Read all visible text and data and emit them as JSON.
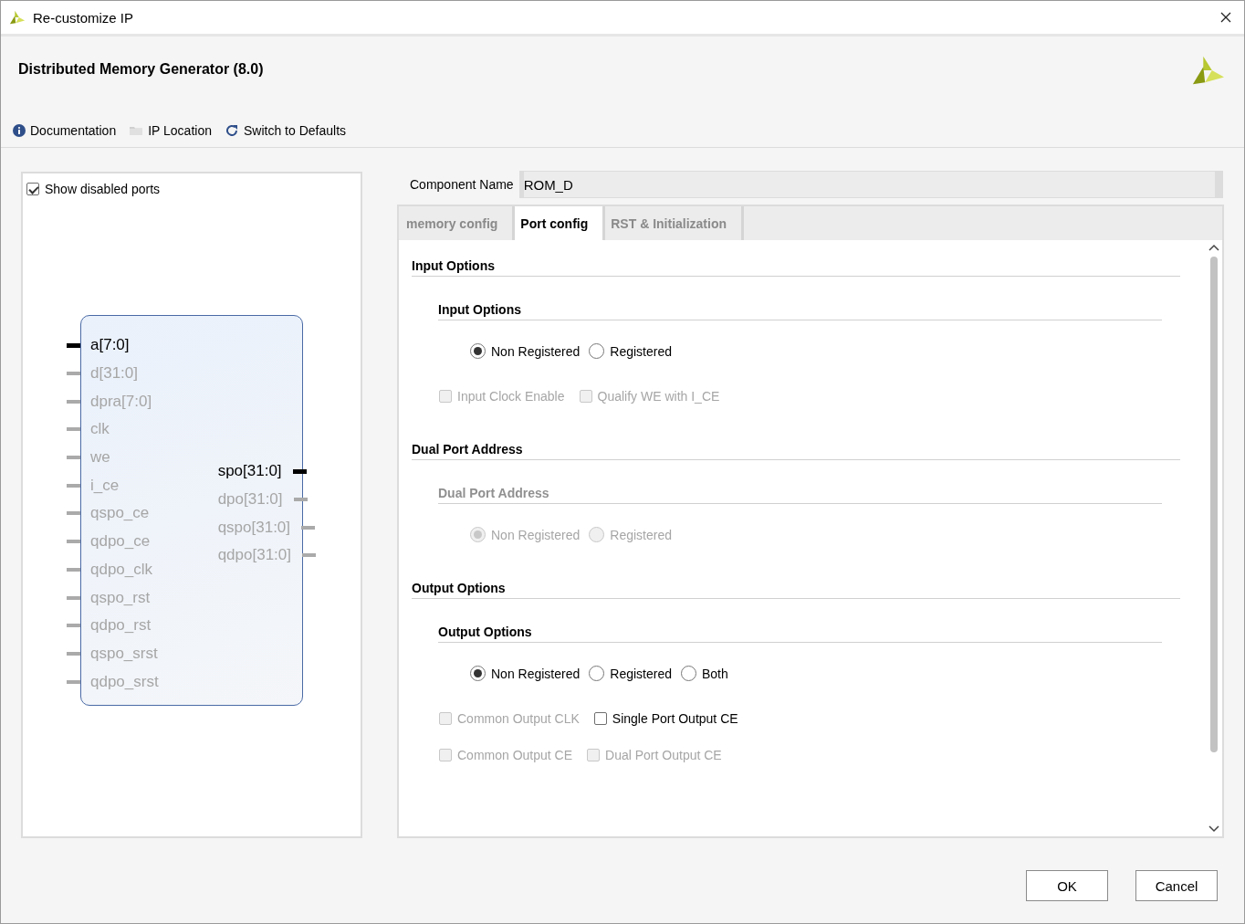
{
  "window": {
    "title": "Re-customize IP"
  },
  "header": {
    "title": "Distributed Memory Generator (8.0)"
  },
  "toolbar": [
    {
      "label": "Documentation",
      "kind": "info"
    },
    {
      "label": "IP Location",
      "kind": "folder"
    },
    {
      "label": "Switch to Defaults",
      "kind": "refresh"
    }
  ],
  "show_disabled_ports": {
    "label": "Show disabled ports",
    "checked": true
  },
  "symbol": {
    "inputs": [
      {
        "name": "a[7:0]",
        "enabled": true
      },
      {
        "name": "d[31:0]",
        "enabled": false
      },
      {
        "name": "dpra[7:0]",
        "enabled": false
      },
      {
        "name": "clk",
        "enabled": false
      },
      {
        "name": "we",
        "enabled": false
      },
      {
        "name": "i_ce",
        "enabled": false
      },
      {
        "name": "qspo_ce",
        "enabled": false
      },
      {
        "name": "qdpo_ce",
        "enabled": false
      },
      {
        "name": "qdpo_clk",
        "enabled": false
      },
      {
        "name": "qspo_rst",
        "enabled": false
      },
      {
        "name": "qdpo_rst",
        "enabled": false
      },
      {
        "name": "qspo_srst",
        "enabled": false
      },
      {
        "name": "qdpo_srst",
        "enabled": false
      }
    ],
    "outputs": [
      {
        "name": "spo[31:0]",
        "enabled": true
      },
      {
        "name": "dpo[31:0]",
        "enabled": false
      },
      {
        "name": "qspo[31:0]",
        "enabled": false
      },
      {
        "name": "qdpo[31:0]",
        "enabled": false
      }
    ]
  },
  "component_name": {
    "label": "Component Name",
    "value": "ROM_D"
  },
  "tabs": [
    {
      "label": "memory config",
      "selected": false
    },
    {
      "label": "Port config",
      "selected": true
    },
    {
      "label": "RST & Initialization",
      "selected": false
    }
  ],
  "sections": [
    {
      "title": "Input Options",
      "subsections": [
        {
          "title": "Input Options",
          "disabled": false,
          "rows": [
            {
              "kind": "radio",
              "items": [
                {
                  "label": "Non Registered",
                  "selected": true,
                  "disabled": false
                },
                {
                  "label": "Registered",
                  "selected": false,
                  "disabled": false
                }
              ]
            },
            {
              "kind": "checkbox",
              "items": [
                {
                  "label": "Input Clock Enable",
                  "checked": false,
                  "disabled": true
                },
                {
                  "label": "Qualify WE with I_CE",
                  "checked": false,
                  "disabled": true
                }
              ]
            }
          ]
        }
      ]
    },
    {
      "title": "Dual Port Address",
      "subsections": [
        {
          "title": "Dual Port Address",
          "disabled": true,
          "rows": [
            {
              "kind": "radio",
              "items": [
                {
                  "label": "Non Registered",
                  "selected": true,
                  "disabled": true
                },
                {
                  "label": "Registered",
                  "selected": false,
                  "disabled": true
                }
              ]
            }
          ]
        }
      ]
    },
    {
      "title": "Output Options",
      "subsections": [
        {
          "title": "Output Options",
          "disabled": false,
          "rows": [
            {
              "kind": "radio",
              "items": [
                {
                  "label": "Non Registered",
                  "selected": true,
                  "disabled": false
                },
                {
                  "label": "Registered",
                  "selected": false,
                  "disabled": false
                },
                {
                  "label": "Both",
                  "selected": false,
                  "disabled": false
                }
              ]
            },
            {
              "kind": "checkbox",
              "items": [
                {
                  "label": "Common Output CLK",
                  "checked": false,
                  "disabled": true
                },
                {
                  "label": "Single Port Output CE",
                  "checked": false,
                  "disabled": false
                }
              ]
            },
            {
              "kind": "checkbox",
              "items": [
                {
                  "label": "Common Output CE",
                  "checked": false,
                  "disabled": true
                },
                {
                  "label": "Dual Port Output CE",
                  "checked": false,
                  "disabled": true
                }
              ]
            }
          ]
        }
      ]
    }
  ],
  "buttons": [
    {
      "label": "OK"
    },
    {
      "label": "Cancel"
    }
  ]
}
